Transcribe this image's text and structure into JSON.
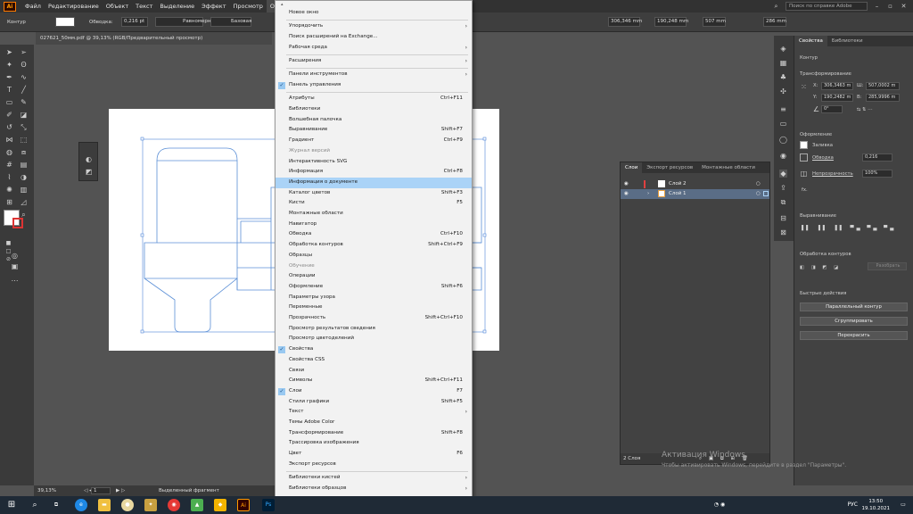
{
  "menubar": {
    "app_icon": "Ai",
    "items": [
      "Файл",
      "Редактирование",
      "Объект",
      "Текст",
      "Выделение",
      "Эффект",
      "Просмотр",
      "Окно"
    ],
    "search_placeholder": "Поиск по справке Adobe"
  },
  "control_bar": {
    "label_contour": "Контур",
    "label_stroke": "Обводка:",
    "stroke_value": "0,216 pt",
    "profile": "Равномерно",
    "brush": "Базовая",
    "x": "306,346 mm",
    "y": "190,248 mm",
    "w": "507 mm",
    "h": "286 mm"
  },
  "document": {
    "tab_title": "027621_50мм.pdf @ 39,13% (RGB/Предварительный просмотр)"
  },
  "status": {
    "zoom": "39,13%",
    "page": "1",
    "tool": "Выделенный фрагмент"
  },
  "window_menu": {
    "items": [
      {
        "label": "Новое окно",
        "shortcut": "",
        "submenu": false,
        "checked": false,
        "disabled": false
      },
      {
        "sep": true
      },
      {
        "label": "Упорядочить",
        "shortcut": "",
        "submenu": true,
        "checked": false,
        "disabled": false
      },
      {
        "label": "Поиск расширений на Exchange...",
        "shortcut": "",
        "submenu": false,
        "checked": false,
        "disabled": false
      },
      {
        "label": "Рабочая среда",
        "shortcut": "",
        "submenu": true,
        "checked": false,
        "disabled": false
      },
      {
        "sep": true
      },
      {
        "label": "Расширения",
        "shortcut": "",
        "submenu": true,
        "checked": false,
        "disabled": false
      },
      {
        "sep": true
      },
      {
        "label": "Панели инструментов",
        "shortcut": "",
        "submenu": true,
        "checked": false,
        "disabled": false
      },
      {
        "label": "Панель управления",
        "shortcut": "",
        "submenu": false,
        "checked": true,
        "disabled": false
      },
      {
        "sep": true
      },
      {
        "label": "Атрибуты",
        "shortcut": "Ctrl+F11",
        "submenu": false,
        "checked": false,
        "disabled": false
      },
      {
        "label": "Библиотеки",
        "shortcut": "",
        "submenu": false,
        "checked": false,
        "disabled": false
      },
      {
        "label": "Волшебная палочка",
        "shortcut": "",
        "submenu": false,
        "checked": false,
        "disabled": false
      },
      {
        "label": "Выравнивание",
        "shortcut": "Shift+F7",
        "submenu": false,
        "checked": false,
        "disabled": false
      },
      {
        "label": "Градиент",
        "shortcut": "Ctrl+F9",
        "submenu": false,
        "checked": false,
        "disabled": false
      },
      {
        "label": "Журнал версий",
        "shortcut": "",
        "submenu": false,
        "checked": false,
        "disabled": true
      },
      {
        "label": "Интерактивность SVG",
        "shortcut": "",
        "submenu": false,
        "checked": false,
        "disabled": false
      },
      {
        "label": "Информация",
        "shortcut": "Ctrl+F8",
        "submenu": false,
        "checked": false,
        "disabled": false
      },
      {
        "label": "Информация о документе",
        "shortcut": "",
        "submenu": false,
        "checked": false,
        "disabled": false,
        "highlight": true
      },
      {
        "label": "Каталог цветов",
        "shortcut": "Shift+F3",
        "submenu": false,
        "checked": false,
        "disabled": false
      },
      {
        "label": "Кисти",
        "shortcut": "F5",
        "submenu": false,
        "checked": false,
        "disabled": false
      },
      {
        "label": "Монтажные области",
        "shortcut": "",
        "submenu": false,
        "checked": false,
        "disabled": false
      },
      {
        "label": "Навигатор",
        "shortcut": "",
        "submenu": false,
        "checked": false,
        "disabled": false
      },
      {
        "label": "Обводка",
        "shortcut": "Ctrl+F10",
        "submenu": false,
        "checked": false,
        "disabled": false
      },
      {
        "label": "Обработка контуров",
        "shortcut": "Shift+Ctrl+F9",
        "submenu": false,
        "checked": false,
        "disabled": false
      },
      {
        "label": "Образцы",
        "shortcut": "",
        "submenu": false,
        "checked": false,
        "disabled": false
      },
      {
        "label": "Обучение",
        "shortcut": "",
        "submenu": false,
        "checked": false,
        "disabled": true
      },
      {
        "label": "Операции",
        "shortcut": "",
        "submenu": false,
        "checked": false,
        "disabled": false
      },
      {
        "label": "Оформление",
        "shortcut": "Shift+F6",
        "submenu": false,
        "checked": false,
        "disabled": false
      },
      {
        "label": "Параметры узора",
        "shortcut": "",
        "submenu": false,
        "checked": false,
        "disabled": false
      },
      {
        "label": "Переменные",
        "shortcut": "",
        "submenu": false,
        "checked": false,
        "disabled": false
      },
      {
        "label": "Прозрачность",
        "shortcut": "Shift+Ctrl+F10",
        "submenu": false,
        "checked": false,
        "disabled": false
      },
      {
        "label": "Просмотр результатов сведения",
        "shortcut": "",
        "submenu": false,
        "checked": false,
        "disabled": false
      },
      {
        "label": "Просмотр цветоделений",
        "shortcut": "",
        "submenu": false,
        "checked": false,
        "disabled": false
      },
      {
        "label": "Свойства",
        "shortcut": "",
        "submenu": false,
        "checked": true,
        "disabled": false
      },
      {
        "label": "Свойства CSS",
        "shortcut": "",
        "submenu": false,
        "checked": false,
        "disabled": false
      },
      {
        "label": "Связи",
        "shortcut": "",
        "submenu": false,
        "checked": false,
        "disabled": false
      },
      {
        "label": "Символы",
        "shortcut": "Shift+Ctrl+F11",
        "submenu": false,
        "checked": false,
        "disabled": false
      },
      {
        "label": "Слои",
        "shortcut": "F7",
        "submenu": false,
        "checked": true,
        "disabled": false
      },
      {
        "label": "Стили графики",
        "shortcut": "Shift+F5",
        "submenu": false,
        "checked": false,
        "disabled": false
      },
      {
        "label": "Текст",
        "shortcut": "",
        "submenu": true,
        "checked": false,
        "disabled": false
      },
      {
        "label": "Темы Adobe Color",
        "shortcut": "",
        "submenu": false,
        "checked": false,
        "disabled": false
      },
      {
        "label": "Трансформирование",
        "shortcut": "Shift+F8",
        "submenu": false,
        "checked": false,
        "disabled": false
      },
      {
        "label": "Трассировка изображения",
        "shortcut": "",
        "submenu": false,
        "checked": false,
        "disabled": false
      },
      {
        "label": "Цвет",
        "shortcut": "F6",
        "submenu": false,
        "checked": false,
        "disabled": false
      },
      {
        "label": "Экспорт ресурсов",
        "shortcut": "",
        "submenu": false,
        "checked": false,
        "disabled": false
      },
      {
        "sep": true
      },
      {
        "label": "Библиотеки кистей",
        "shortcut": "",
        "submenu": true,
        "checked": false,
        "disabled": false
      },
      {
        "label": "Библиотеки образцов",
        "shortcut": "",
        "submenu": true,
        "checked": false,
        "disabled": false
      }
    ]
  },
  "layers_panel": {
    "tabs": [
      "Слои",
      "Экспорт ресурсов",
      "Монтажные области"
    ],
    "layers": [
      {
        "name": "Слой 2",
        "color": "#e04040"
      },
      {
        "name": "Слой 1",
        "color": "#4a7fd0"
      }
    ],
    "footer": "2 Слоя"
  },
  "properties_panel": {
    "tabs": [
      "Свойства",
      "Библиотеки"
    ],
    "contour_label": "Контур",
    "transform_label": "Трансформирование",
    "x": "306,3463 m",
    "y": "190,2482 m",
    "w": "507,0002 m",
    "h": "285,9996 m",
    "angle": "0°",
    "appearance_label": "Оформление",
    "fill_label": "Заливка",
    "stroke_label": "Обводка",
    "stroke_value": "0,216",
    "opacity_label": "Непрозрачность",
    "opacity_value": "100%",
    "fx_label": "fx.",
    "align_label": "Выравнивание",
    "pathfinder_label": "Обработка контуров",
    "expand_label": "Разобрать",
    "quick_actions_label": "Быстрые действия",
    "btn_offset": "Параллельный контур",
    "btn_group": "Сгруппировать",
    "btn_recolor": "Перекрасить"
  },
  "watermark": {
    "title": "Активация Windows",
    "subtitle": "Чтобы активировать Windows, перейдите в раздел \"Параметры\"."
  },
  "taskbar": {
    "lang": "РУС",
    "time": "13:50",
    "date": "19.10.2021"
  },
  "colors": {
    "accent_orange": "#ff9a00",
    "menu_highlight": "#aad3f7",
    "dieline_blue": "#5b8fd6"
  }
}
